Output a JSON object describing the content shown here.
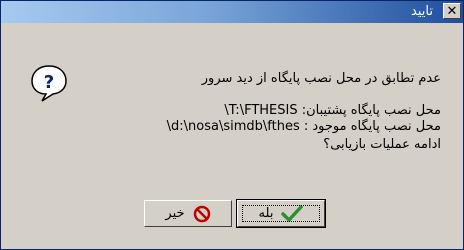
{
  "window": {
    "title": "تایید",
    "close_glyph": "✕"
  },
  "message": {
    "line1": "عدم تطابق در محل نصب پایگاه از دید سرور",
    "line2": "محل نصب پایگاه پشتیبان: T:\\FTHESIS\\",
    "line3": "محل نصب پایگاه موجود : d:\\nosa\\simdb\\fthes\\",
    "line4": "ادامه عملیات بازیابی؟"
  },
  "buttons": {
    "yes_label": "بله",
    "no_label": "خیر"
  },
  "icons": {
    "dialog": "question-icon",
    "yes": "checkmark-icon",
    "no": "no-entry-icon"
  },
  "colors": {
    "title_gradient_start": "#a6caf0",
    "title_gradient_end": "#1e4f9e",
    "dialog_bg": "#d4d0c8",
    "check_green": "#2f8f2f",
    "no_red": "#c00000"
  }
}
